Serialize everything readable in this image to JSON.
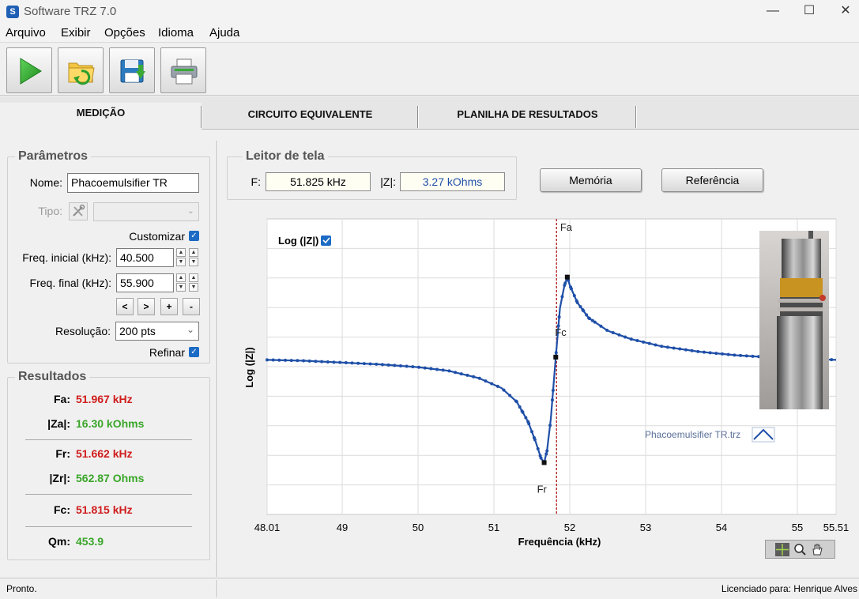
{
  "window": {
    "title": "Software TRZ 7.0",
    "icon_letter": "S",
    "minimize": "—",
    "maximize": "☐",
    "close": "✕"
  },
  "menu": [
    "Arquivo",
    "Exibir",
    "Opções",
    "Idioma",
    "Ajuda"
  ],
  "toolbar": {
    "icons": [
      "play-icon",
      "open-folder-icon",
      "save-icon",
      "print-icon"
    ]
  },
  "tabs": [
    "MEDIÇÃO",
    "CIRCUITO EQUIVALENTE",
    "PLANILHA DE RESULTADOS"
  ],
  "params": {
    "title": "Parâmetros",
    "nome_label": "Nome:",
    "nome_value": "Phacoemulsifier TR",
    "tipo_label": "Tipo:",
    "customizar_label": "Customizar",
    "freq_ini_label": "Freq. inicial (kHz):",
    "freq_ini_value": "40.500",
    "freq_fin_label": "Freq. final (kHz):",
    "freq_fin_value": "55.900",
    "nav_buttons": [
      "<",
      ">",
      "+",
      "-"
    ],
    "resolucao_label": "Resolução:",
    "resolucao_value": "200 pts",
    "refinar_label": "Refinar"
  },
  "results": {
    "title": "Resultados",
    "fa_label": "Fa:",
    "fa_value": "51.967 kHz",
    "za_label": "|Za|:",
    "za_value": "16.30 kOhms",
    "fr_label": "Fr:",
    "fr_value": "51.662 kHz",
    "zr_label": "|Zr|:",
    "zr_value": "562.87 Ohms",
    "fc_label": "Fc:",
    "fc_value": "51.815 kHz",
    "qm_label": "Qm:",
    "qm_value": "453.9"
  },
  "reader": {
    "title": "Leitor de tela",
    "f_label": "F:",
    "f_value": "51.825 kHz",
    "z_label": "|Z|:",
    "z_value": "3.27 kOhms"
  },
  "buttons": {
    "memoria": "Memória",
    "referencia": "Referência"
  },
  "chart_data": {
    "type": "line",
    "title": "",
    "xlabel": "Frequência (kHz)",
    "ylabel": "Log (|Z|)",
    "xlim": [
      48.01,
      55.51
    ],
    "x_ticks": [
      "48.01",
      "49",
      "50",
      "51",
      "52",
      "53",
      "54",
      "55",
      "55.51"
    ],
    "legend_checkbox_label": "Log (|Z|)",
    "file_legend": "Phacoemulsifier TR.trz",
    "markers": {
      "fa": "Fa",
      "fr": "Fr",
      "fc": "Fc"
    },
    "cursor_x": 51.825,
    "grid": true,
    "series": [
      {
        "color": "#1f4fa8",
        "points": [
          [
            48.01,
            3.3
          ],
          [
            48.5,
            3.29
          ],
          [
            49.0,
            3.27
          ],
          [
            49.5,
            3.25
          ],
          [
            50.0,
            3.22
          ],
          [
            50.4,
            3.18
          ],
          [
            50.8,
            3.1
          ],
          [
            51.1,
            2.99
          ],
          [
            51.3,
            2.84
          ],
          [
            51.45,
            2.62
          ],
          [
            51.55,
            2.4
          ],
          [
            51.62,
            2.22
          ],
          [
            51.662,
            2.17
          ],
          [
            51.7,
            2.3
          ],
          [
            51.75,
            2.65
          ],
          [
            51.815,
            3.33
          ],
          [
            51.87,
            3.87
          ],
          [
            51.93,
            4.12
          ],
          [
            51.967,
            4.21
          ],
          [
            52.0,
            4.12
          ],
          [
            52.1,
            3.93
          ],
          [
            52.25,
            3.76
          ],
          [
            52.5,
            3.62
          ],
          [
            52.8,
            3.53
          ],
          [
            53.2,
            3.45
          ],
          [
            53.7,
            3.39
          ],
          [
            54.2,
            3.35
          ],
          [
            54.8,
            3.32
          ],
          [
            55.51,
            3.3
          ]
        ]
      }
    ]
  },
  "status": {
    "left": "Pronto.",
    "right": "Licenciado para: Henrique Alves"
  }
}
